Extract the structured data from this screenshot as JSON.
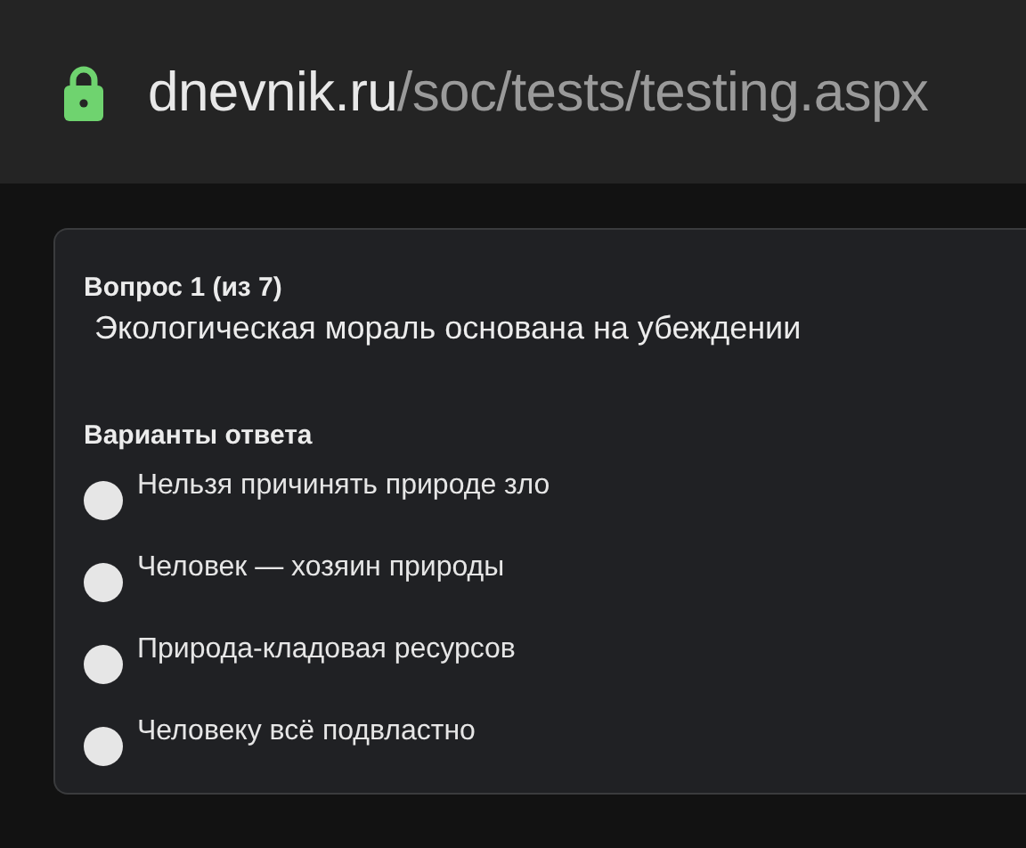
{
  "address_bar": {
    "secure": true,
    "host": "dnevnik.ru",
    "path": "/soc/tests/testing.aspx"
  },
  "question": {
    "number": "Вопрос 1 (из 7)",
    "text": "Экологическая мораль основана на убеждении"
  },
  "answers": {
    "heading": "Варианты ответа",
    "options": [
      {
        "label": "Нельзя причинять природе зло",
        "selected": false
      },
      {
        "label": "Человек — хозяин природы",
        "selected": false
      },
      {
        "label": "Природа-кладовая ресурсов",
        "selected": false
      },
      {
        "label": "Человеку всё подвластно",
        "selected": false
      }
    ]
  }
}
